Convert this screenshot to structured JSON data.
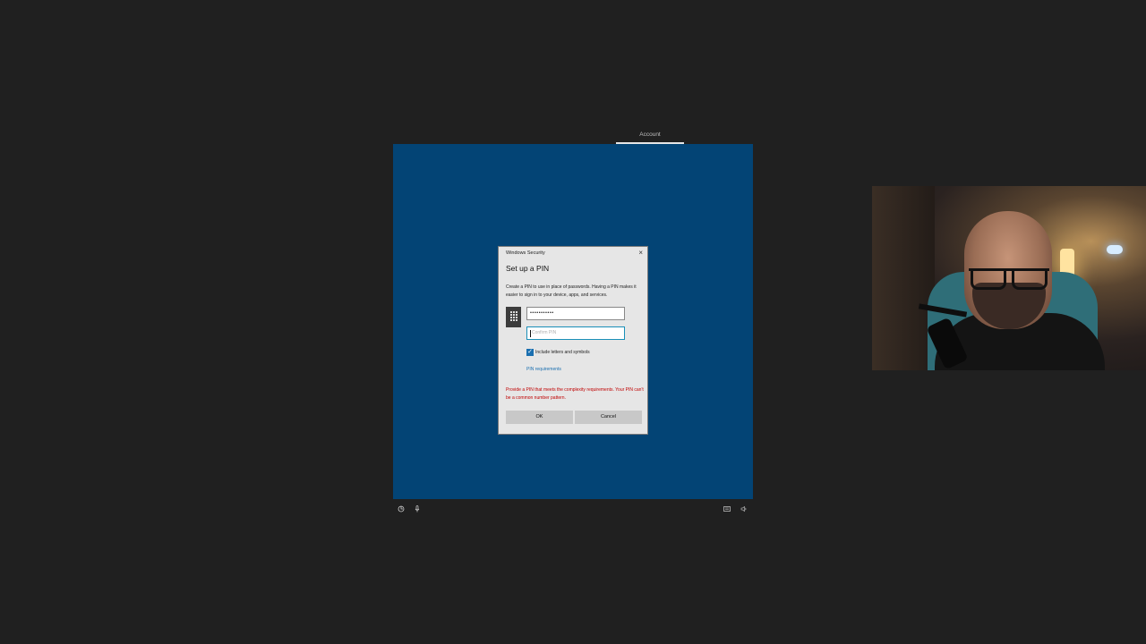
{
  "top_tab": {
    "label": "Account"
  },
  "dialog": {
    "window_title": "Windows Security",
    "close_glyph": "×",
    "heading": "Set up a PIN",
    "description": "Create a PIN to use in place of passwords. Having a PIN makes it easier to sign in to your device, apps, and services.",
    "new_pin_value": "•••••••••••",
    "confirm_pin_placeholder": "Confirm PIN",
    "include_letters_label": "Include letters and symbols",
    "include_letters_checked": true,
    "pin_requirements_link": "PIN requirements",
    "error_message": "Provide a PIN that meets the complexity requirements. Your PIN can't be a common number pattern.",
    "ok_label": "OK",
    "cancel_label": "Cancel"
  },
  "bottom_bar": {
    "left_icons": [
      "ease-of-access-icon",
      "microphone-icon"
    ],
    "right_icons": [
      "keyboard-icon",
      "volume-icon"
    ]
  },
  "colors": {
    "oobe_background": "#034475",
    "error": "#c00000",
    "link": "#1a6fb0",
    "focus_border": "#1a8fb8"
  }
}
